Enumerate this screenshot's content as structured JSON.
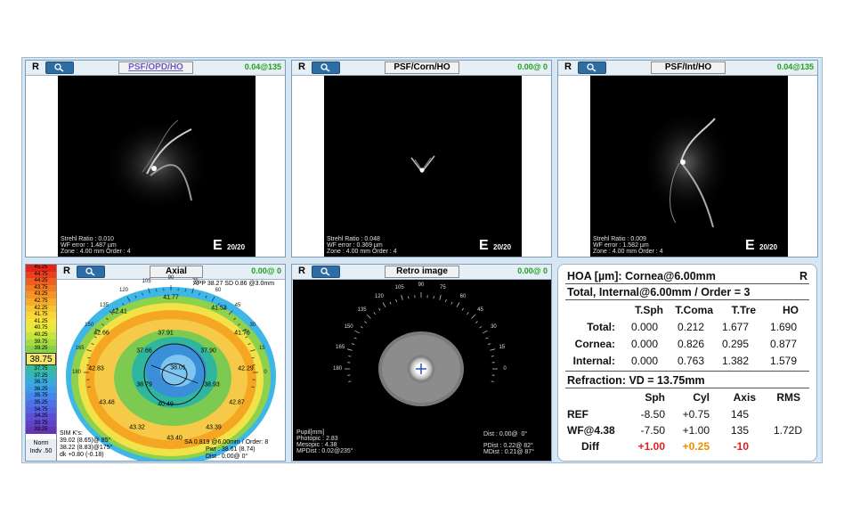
{
  "panels": {
    "psf_opd": {
      "eye": "R",
      "title": "PSF/OPD/HO",
      "value": "0.04@135",
      "strehl": "Strehl Ratio : 0.010",
      "wferr": "WF error : 1.487 µm",
      "zone": "Zone : 4.00 mm Order : 4",
      "acuity": "20/20"
    },
    "psf_corn": {
      "eye": "R",
      "title": "PSF/Corn/HO",
      "value": "0.00@  0",
      "strehl": "Strehl Ratio : 0.048",
      "wferr": "WF error : 0.369 µm",
      "zone": "Zone : 4.00 mm Order : 4",
      "acuity": "20/20"
    },
    "psf_int": {
      "eye": "R",
      "title": "PSF/Int/HO",
      "value": "0.04@135",
      "strehl": "Strehl Ratio : 0.009",
      "wferr": "WF error : 1.582 µm",
      "zone": "Zone : 4.00 mm Order : 4",
      "acuity": "20/20"
    },
    "axial": {
      "eye": "R",
      "title": "Axial",
      "value": "0.00@  0",
      "app": "APP 38.27 SD 0.86 @3.0mm",
      "sim_title": "SIM K's:",
      "sim1": "39.02 (8.65)@ 85°",
      "sim2": "38.22 (8.83)@175°",
      "sim3": "dk +0.80 (-0.18)",
      "sa": "SA  0.819 @6.00mm / Order: 8",
      "pwr": "Pwr :  38.61 (8.74)",
      "dist": "Dist :  0.00@  0°",
      "scale_mode": "Norm",
      "scale_step": "Indv .50",
      "scale_values": [
        "45.25",
        "44.75",
        "44.25",
        "43.75",
        "43.25",
        "42.75",
        "42.25",
        "41.75",
        "41.25",
        "40.75",
        "40.25",
        "39.75",
        "39.25",
        "38.75",
        "38.25",
        "37.75",
        "37.25",
        "36.75",
        "36.25",
        "35.75",
        "35.25",
        "34.75",
        "34.25",
        "33.75",
        "33.25"
      ],
      "current": "38.75",
      "labels": [
        "41.77",
        "41.53",
        "42.41",
        "42.66",
        "41.76",
        "37.91",
        "37.66",
        "37.90",
        "38.01",
        "42.83",
        "42.29",
        "38.79",
        "38.93",
        "43.48",
        "40.49",
        "42.87",
        "43.32",
        "43.40",
        "43.39"
      ],
      "angles": [
        "120",
        "105",
        "90",
        "75",
        "60",
        "135",
        "45",
        "150",
        "30",
        "165",
        "15",
        "180",
        "0"
      ]
    },
    "retro": {
      "eye": "R",
      "title": "Retro image",
      "value": "0.00@  0",
      "dist": "Dist : 0.00@  0°",
      "pupil": "Pupil[mm]",
      "photopic": "Photopic : 2.83",
      "mesopic": "Mesopic : 4.38",
      "mpdist": "MPDist : 0.02@235°",
      "pdist": "PDist : 0.22@ 82°",
      "mdist": "MDist : 0.21@ 87°",
      "angles": [
        "90",
        "105",
        "75",
        "120",
        "60",
        "135",
        "45",
        "150",
        "30",
        "165",
        "15",
        "180",
        "0"
      ]
    }
  },
  "hoa": {
    "eye": "R",
    "title": "HOA [µm]: Cornea@6.00mm",
    "subtitle": "Total, Internal@6.00mm / Order = 3",
    "headers": [
      "T.Sph",
      "T.Coma",
      "T.Tre",
      "HO"
    ],
    "rows": [
      {
        "label": "Total:",
        "values": [
          "0.000",
          "0.212",
          "1.677",
          "1.690"
        ]
      },
      {
        "label": "Cornea:",
        "values": [
          "0.000",
          "0.826",
          "0.295",
          "0.877"
        ]
      },
      {
        "label": "Internal:",
        "values": [
          "0.000",
          "0.763",
          "1.382",
          "1.579"
        ]
      }
    ],
    "refraction_title": "Refraction: VD = 13.75mm",
    "ref_headers": [
      "Sph",
      "Cyl",
      "Axis",
      "RMS"
    ],
    "ref_rows": [
      {
        "label": "REF",
        "values": [
          "-8.50",
          "+0.75",
          "145",
          ""
        ]
      },
      {
        "label": "WF@4.38",
        "values": [
          "-7.50",
          "+1.00",
          "135",
          "1.72D"
        ]
      },
      {
        "label": "Diff",
        "values": [
          "+1.00",
          "+0.25",
          "-10",
          ""
        ]
      }
    ],
    "diff_colors": [
      "#e02020",
      "#f08c00",
      "#e02020"
    ]
  }
}
